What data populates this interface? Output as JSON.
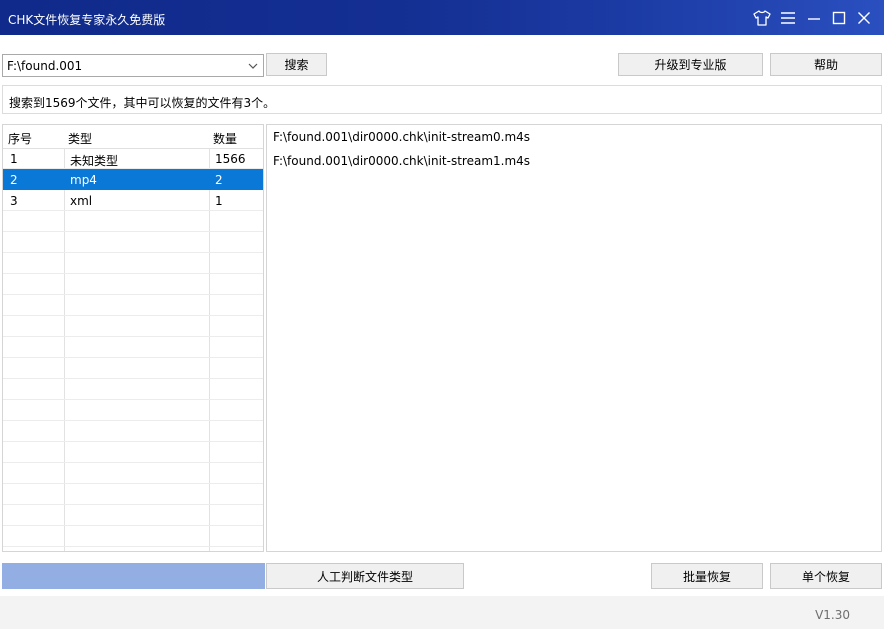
{
  "titlebar": {
    "title": "CHK文件恢复专家永久免费版",
    "icons": [
      "tshirt-skin-icon",
      "menu-icon",
      "minimize-icon",
      "maximize-icon",
      "close-icon"
    ]
  },
  "toolbar": {
    "path_value": "F:\\found.001",
    "search_label": "搜索",
    "upgrade_label": "升级到专业版",
    "help_label": "帮助"
  },
  "status": {
    "message": "搜索到1569个文件，其中可以恢复的文件有3个。"
  },
  "type_table": {
    "headers": [
      "序号",
      "类型",
      "数量"
    ],
    "rows": [
      {
        "index": "1",
        "type": "未知类型",
        "count": "1566",
        "selected": false
      },
      {
        "index": "2",
        "type": "mp4",
        "count": "2",
        "selected": true
      },
      {
        "index": "3",
        "type": "xml",
        "count": "1",
        "selected": false
      }
    ]
  },
  "file_list": [
    "F:\\found.001\\dir0000.chk\\init-stream0.m4s",
    "F:\\found.001\\dir0000.chk\\init-stream1.m4s"
  ],
  "actions": {
    "manual_type_label": "人工判断文件类型",
    "batch_restore_label": "批量恢复",
    "single_restore_label": "单个恢复"
  },
  "footer": {
    "version": "V1.30"
  },
  "colors": {
    "titlebar": "#142f92",
    "selection": "#0a78d7",
    "progress": "#92aee3"
  }
}
